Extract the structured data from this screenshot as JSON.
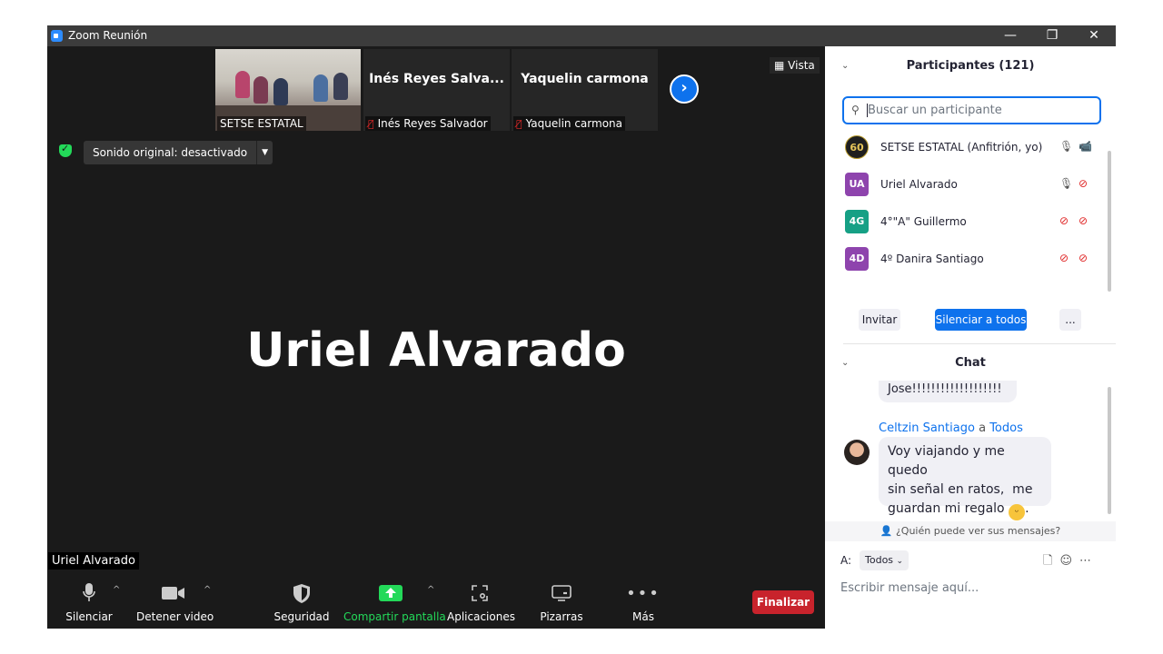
{
  "window": {
    "title": "Zoom Reunión",
    "minimize": "—",
    "restore": "❐",
    "close": "✕"
  },
  "thumbnails": [
    {
      "name_tag": "SETSE ESTATAL"
    },
    {
      "big_name": "Inés Reyes Salva...",
      "name_tag": "Inés Reyes Salvador"
    },
    {
      "big_name": "Yaquelin carmona",
      "name_tag": "Yaquelin carmona"
    }
  ],
  "view_button": "Vista",
  "sound_button": "Sonido original: desactivado",
  "active_speaker": "Uriel Alvarado",
  "speaker_tag": "Uriel Alvarado",
  "toolbar": {
    "mute": "Silenciar",
    "stop_video": "Detener video",
    "security": "Seguridad",
    "share": "Compartir pantalla",
    "apps": "Aplicaciones",
    "whiteboards": "Pizarras",
    "more": "Más",
    "end": "Finalizar"
  },
  "participants": {
    "header": "Participantes (121)",
    "search_placeholder": "Buscar un participante",
    "list": [
      {
        "initials": "60",
        "name": "SETSE ESTATAL (Anfitrión, yo)",
        "color": "#1f1f1f",
        "mic_muted": false,
        "cam_off": false
      },
      {
        "initials": "UA",
        "name": "Uriel Alvarado",
        "color": "#8e44ad",
        "mic_muted": false,
        "cam_off": true
      },
      {
        "initials": "4G",
        "name": "4°\"A\" Guillermo",
        "color": "#16a085",
        "mic_muted": true,
        "cam_off": true
      },
      {
        "initials": "4D",
        "name": "4º Danira Santiago",
        "color": "#8e44ad",
        "mic_muted": true,
        "cam_off": true
      }
    ],
    "invite": "Invitar",
    "mute_all": "Silenciar a todos",
    "more": "..."
  },
  "chat": {
    "header": "Chat",
    "prev_message": "Jose!!!!!!!!!!!!!!!!!!!",
    "sender_name": "Celtzin Santiago",
    "sender_to_word": "a",
    "sender_to": "Todos",
    "message_line1": "Voy viajando y me quedo",
    "message_line2": "sin señal en ratos,  me",
    "message_line3": "guardan mi regalo",
    "who_sees": "¿Quién puede ver sus mensajes?",
    "to_label": "A:",
    "to_value": "Todos",
    "input_placeholder": "Escribir mensaje aquí..."
  },
  "colors": {
    "accent": "#0e72ed",
    "end_red": "#c8232c",
    "share_green": "#23d959"
  }
}
